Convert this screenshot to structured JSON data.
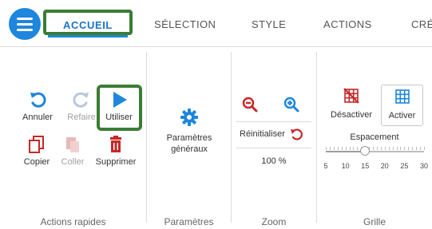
{
  "tabs": {
    "active": "ACCUEIL",
    "items": [
      "SÉLECTION",
      "STYLE",
      "ACTIONS",
      "CRÉ"
    ]
  },
  "groups": {
    "quick_actions": {
      "label": "Actions rapides",
      "undo": "Annuler",
      "redo": "Refaire",
      "use": "Utiliser",
      "copy": "Copier",
      "paste": "Coller",
      "delete": "Supprimer"
    },
    "settings": {
      "label": "Paramètres",
      "general_line1": "Paramètres",
      "general_line2": "généraux"
    },
    "zoom": {
      "label": "Zoom",
      "reset": "Réinitialiser",
      "value": "100 %"
    },
    "grid": {
      "label": "Grille",
      "disable": "Désactiver",
      "enable": "Activer",
      "spacing_label": "Espacement",
      "ticks": [
        "5",
        "10",
        "15",
        "20",
        "25",
        "30"
      ],
      "spacing_value": 15
    }
  },
  "colors": {
    "accent": "#1e86dc",
    "highlight": "#3a7d33",
    "red": "#c62828",
    "disabled": "#b9c9dc"
  }
}
